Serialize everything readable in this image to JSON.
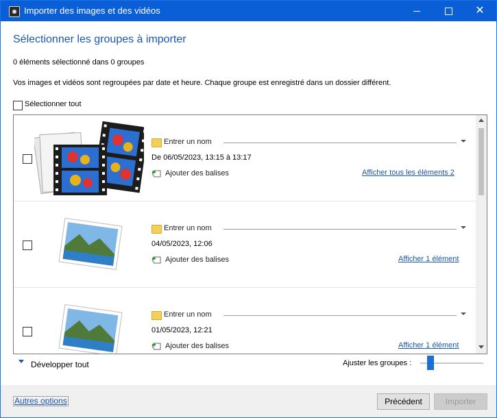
{
  "window": {
    "title": "Importer des images et des vidéos"
  },
  "header": {
    "heading": "Sélectionner les groupes à importer",
    "selection_count": "0 éléments sélectionné dans 0 groupes",
    "description": "Vos images et vidéos sont regroupées par date et heure. Chaque groupe est enregistré dans un dossier différent."
  },
  "select_all": {
    "label": "Sélectionner tout",
    "checked": false
  },
  "groups": [
    {
      "checked": false,
      "name_placeholder": "Entrer un nom",
      "date": "De 06/05/2023, 13:15 à 13:17",
      "tags_label": "Ajouter des balises",
      "link": "Afficher tous les éléments 2",
      "thumb": "film-and-photo-stack-icon"
    },
    {
      "checked": false,
      "name_placeholder": "Entrer un nom",
      "date": "04/05/2023, 12:06",
      "tags_label": "Ajouter des balises",
      "link": "Afficher 1 élément",
      "thumb": "landscape-photo-icon"
    },
    {
      "checked": false,
      "name_placeholder": "Entrer un nom",
      "date": "01/05/2023, 12:21",
      "tags_label": "Ajouter des balises",
      "link": "Afficher 1 élément",
      "thumb": "landscape-photo-icon"
    }
  ],
  "bottom": {
    "expand_all": "Développer tout",
    "adjust_groups": "Ajuster les groupes :",
    "adjust_groups_level": 0.15
  },
  "footer": {
    "more_options": "Autres options",
    "previous": "Précédent",
    "import": "Importer"
  },
  "colors": {
    "titlebar": "#0a5fd6",
    "link": "#1a56b0",
    "accent": "#1a6fd6"
  }
}
